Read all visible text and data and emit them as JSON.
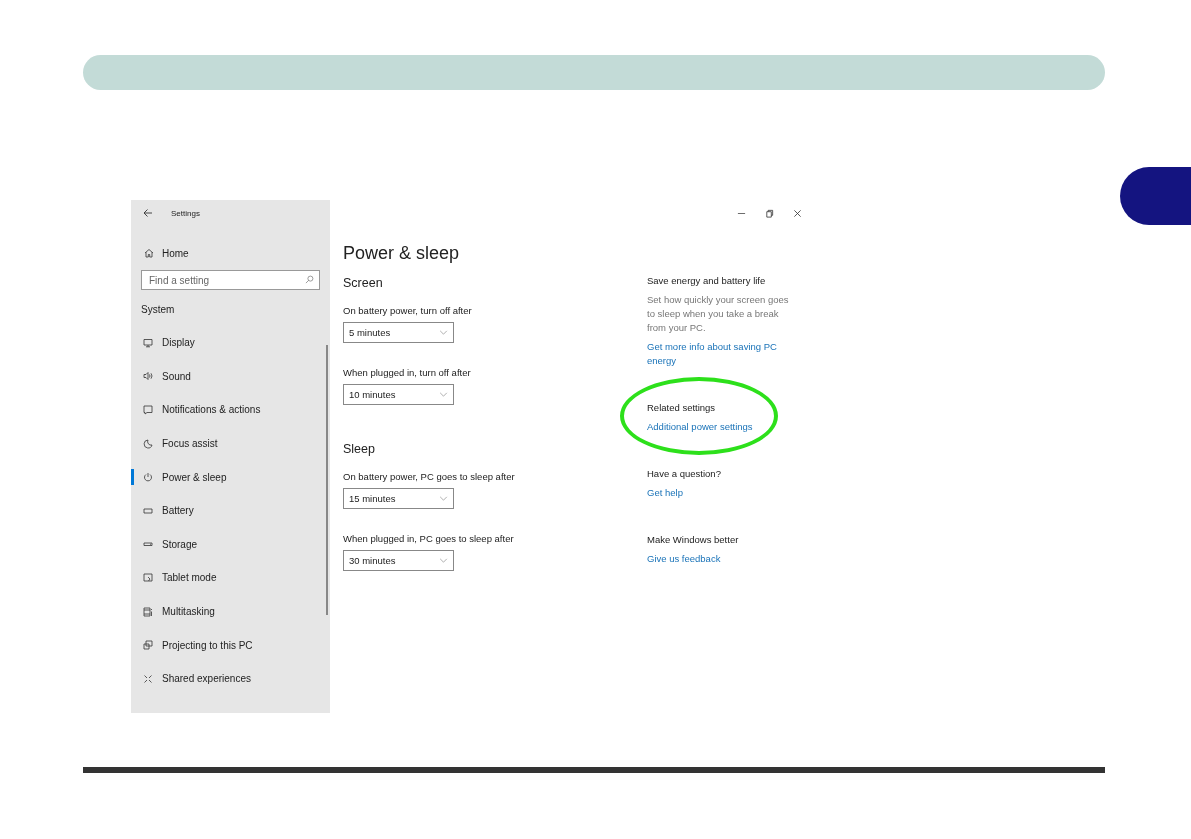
{
  "window": {
    "title": "Settings"
  },
  "sidebar": {
    "home": "Home",
    "search": {
      "placeholder": "Find a setting"
    },
    "section": "System",
    "items": [
      {
        "label": "Display",
        "selected": false
      },
      {
        "label": "Sound",
        "selected": false
      },
      {
        "label": "Notifications & actions",
        "selected": false
      },
      {
        "label": "Focus assist",
        "selected": false
      },
      {
        "label": "Power & sleep",
        "selected": true
      },
      {
        "label": "Battery",
        "selected": false
      },
      {
        "label": "Storage",
        "selected": false
      },
      {
        "label": "Tablet mode",
        "selected": false
      },
      {
        "label": "Multitasking",
        "selected": false
      },
      {
        "label": "Projecting to this PC",
        "selected": false
      },
      {
        "label": "Shared experiences",
        "selected": false
      }
    ]
  },
  "main": {
    "title": "Power & sleep",
    "sections": [
      {
        "heading": "Screen",
        "settings": [
          {
            "label": "On battery power, turn off after",
            "value": "5 minutes"
          },
          {
            "label": "When plugged in, turn off after",
            "value": "10 minutes"
          }
        ]
      },
      {
        "heading": "Sleep",
        "settings": [
          {
            "label": "On battery power, PC goes to sleep after",
            "value": "15 minutes"
          },
          {
            "label": "When plugged in, PC goes to sleep after",
            "value": "30 minutes"
          }
        ]
      }
    ]
  },
  "related": [
    {
      "heading": "Save energy and battery life",
      "description": "Set how quickly your screen goes to sleep when you take a break from your PC.",
      "link": "Get more info about saving PC energy",
      "highlighted": false
    },
    {
      "heading": "Related settings",
      "link": "Additional power settings",
      "highlighted": true
    },
    {
      "heading": "Have a question?",
      "link": "Get help",
      "highlighted": false
    },
    {
      "heading": "Make Windows better",
      "link": "Give us feedback",
      "highlighted": false
    }
  ]
}
